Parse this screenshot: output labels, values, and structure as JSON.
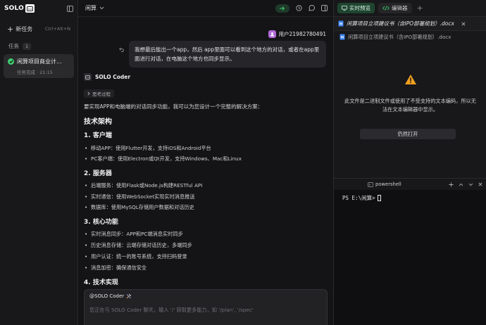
{
  "sidebar": {
    "logo_text": "SOLO",
    "new_task_label": "新任务",
    "new_task_shortcut": "Ctrl+Alt+N",
    "tasks_label": "任务",
    "tasks_count": "1",
    "task": {
      "title": "闲算项目商业计...",
      "subtitle": "任务完成 · 21:15",
      "status_color": "#3ecf6f"
    }
  },
  "chat": {
    "title": "闲算",
    "user_name": "用户21982780491",
    "user_message": "我想最后能出一个app，然后 app里面可以看到这个地方的对话，或者在app里面进行对话，在电脑这个地方也同步显示。",
    "bot_name": "SOLO Coder",
    "thinking_label": "思考过程",
    "intro": "要实现APP和电脑端的对话同步功能，我可以为您设计一个完整的解决方案：",
    "arch_heading": "技术架构",
    "sections": [
      {
        "heading": "1. 客户端",
        "items": [
          "移动APP：使用Flutter开发，支持iOS和Android平台",
          "PC客户端：使用Electron或Qt开发，支持Windows、Mac和Linux"
        ]
      },
      {
        "heading": "2. 服务器",
        "items": [
          "后端服务：使用Flask或Node.js构建RESTful API",
          "实时通信：使用WebSocket实现实时消息推送",
          "数据库：使用MySQL存储用户数据和对话历史"
        ]
      },
      {
        "heading": "3. 核心功能",
        "items": [
          "实时消息同步：APP和PC端消息实时同步",
          "历史消息存储：云端存储对话历史，多端同步",
          "用户认证：统一的账号系统，支持扫码登录",
          "消息加密：确保通信安全"
        ]
      },
      {
        "heading": "4. 技术实现",
        "items": []
      }
    ],
    "composer": {
      "mention": "@SOLO Coder",
      "placeholder": "您正在与 SOLO Coder 聊天，输入 '/' 获取更多能力，如 '/plan', '/spec'"
    }
  },
  "right_panel": {
    "tabs": [
      {
        "label": "实时预览",
        "active": true
      },
      {
        "label": "编辑器",
        "active": false
      }
    ],
    "file_tab_name": "闲算项目立项建议书（含IPO部署规划）.docx",
    "breadcrumb": "闲算项目立项建议书（含IPO部署规划）.docx",
    "warning_message": "此文件是二进制文件或使用了不受支持的文本编码，所以无法在文本编辑器中显示。",
    "open_anyway_label": "仍然打开",
    "terminal": {
      "shell_name": "powershell",
      "prompt": "PS E:\\闲算>"
    }
  },
  "colors": {
    "accent_green": "#3ecf6f",
    "warning": "#f0a020",
    "word_blue": "#3b82f6"
  }
}
